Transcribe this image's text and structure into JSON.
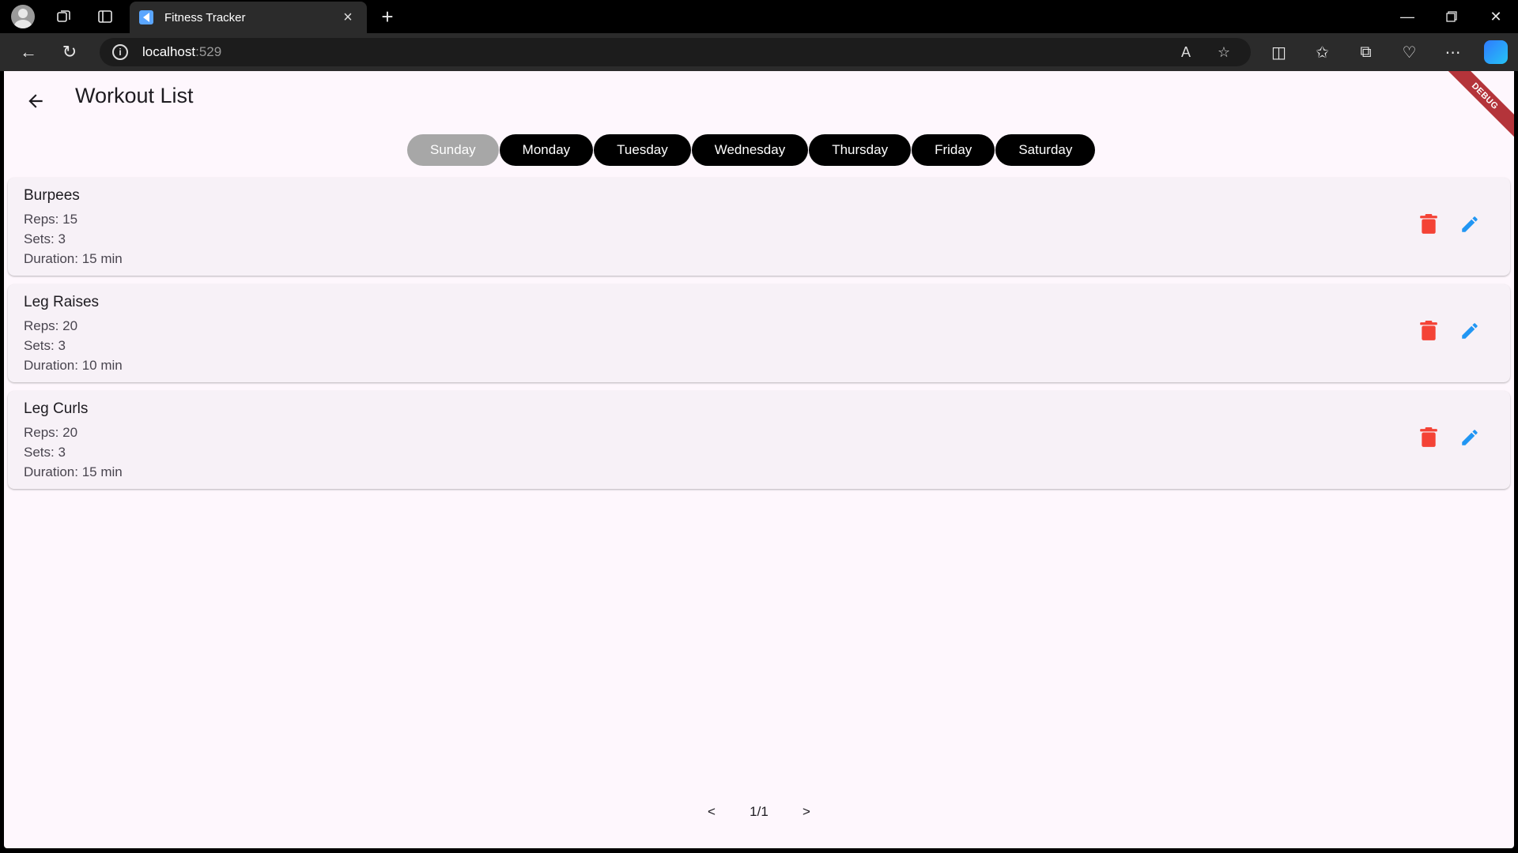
{
  "browser": {
    "tab_title": "Fitness Tracker",
    "url_host": "localhost",
    "url_port": ":529"
  },
  "app": {
    "title": "Workout List",
    "debug_label": "DEBUG",
    "days": [
      {
        "label": "Sunday",
        "selected": true
      },
      {
        "label": "Monday",
        "selected": false
      },
      {
        "label": "Tuesday",
        "selected": false
      },
      {
        "label": "Wednesday",
        "selected": false
      },
      {
        "label": "Thursday",
        "selected": false
      },
      {
        "label": "Friday",
        "selected": false
      },
      {
        "label": "Saturday",
        "selected": false
      }
    ],
    "workouts": [
      {
        "name": "Burpees",
        "reps": "Reps: 15",
        "sets": "Sets: 3",
        "duration": "Duration: 15 min"
      },
      {
        "name": "Leg Raises",
        "reps": "Reps: 20",
        "sets": "Sets: 3",
        "duration": "Duration: 10 min"
      },
      {
        "name": "Leg Curls",
        "reps": "Reps: 20",
        "sets": "Sets: 3",
        "duration": "Duration: 15 min"
      }
    ],
    "pager": {
      "prev": "<",
      "page": "1/1",
      "next": ">"
    }
  },
  "colors": {
    "delete": "#f44336",
    "edit": "#2196f3",
    "chip_active": "#a7a7a7",
    "chip_default": "#000000"
  }
}
